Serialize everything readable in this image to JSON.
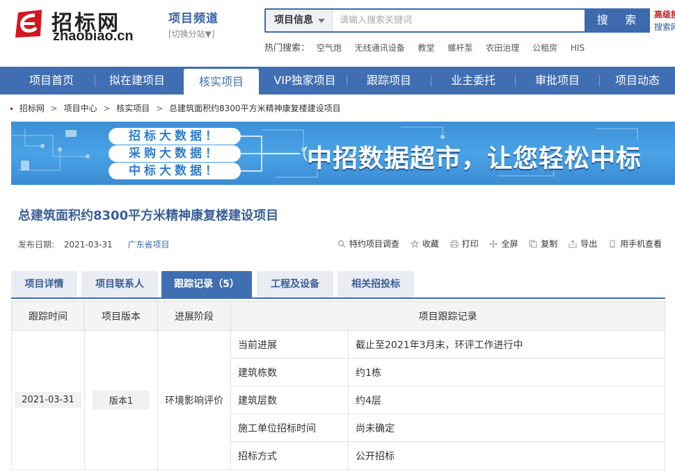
{
  "logo": {
    "cn": "招标网",
    "en": "zhaobiao.cn"
  },
  "channel": {
    "title": "项目频道",
    "switch": "[切换分站▼]"
  },
  "search": {
    "category": "项目信息",
    "placeholder": "请输入搜索关键词",
    "button": "搜 索",
    "advanced": "高级搜",
    "advanced2": "搜索网"
  },
  "hot": {
    "label": "热门搜索：",
    "items": [
      "空气炮",
      "无线通讯设备",
      "教堂",
      "螺杆泵",
      "农田治理",
      "公租房",
      "HIS"
    ]
  },
  "nav": {
    "items": [
      "项目首页",
      "拟在建项目",
      "核实项目",
      "VIP独家项目",
      "跟踪项目",
      "业主委托",
      "审批项目",
      "项目动态"
    ],
    "active_index": 2
  },
  "breadcrumb": [
    "招标网",
    "项目中心",
    "核实项目",
    "总建筑面积约8300平方米精神康复楼建设项目"
  ],
  "banner": {
    "pills": [
      "招标大数据！",
      "采购大数据！",
      "中标大数据！"
    ],
    "slogan": "中招数据超市，让您轻松中标"
  },
  "project": {
    "title": "总建筑面积约8300平方米精神康复楼建设项目",
    "date_label": "发布日期:",
    "date": "2021-03-31",
    "region": "广东省项目"
  },
  "tools": [
    {
      "icon": "search-icon",
      "label": "特约项目调查"
    },
    {
      "icon": "star-icon",
      "label": "收藏"
    },
    {
      "icon": "printer-icon",
      "label": "打印"
    },
    {
      "icon": "fullscreen-icon",
      "label": "全屏"
    },
    {
      "icon": "copy-icon",
      "label": "复制"
    },
    {
      "icon": "export-icon",
      "label": "导出"
    },
    {
      "icon": "phone-icon",
      "label": "用手机查看"
    }
  ],
  "tabs": [
    "项目详情",
    "项目联系人",
    "跟踪记录（5）",
    "工程及设备",
    "相关招投标"
  ],
  "active_tab": 2,
  "table": {
    "headers": [
      "跟踪时间",
      "项目版本",
      "进展阶段",
      "项目跟踪记录"
    ],
    "time": "2021-03-31",
    "version": "版本1",
    "stage": "环境影响评价",
    "records": [
      {
        "k": "当前进展",
        "v": "截止至2021年3月末，环评工作进行中"
      },
      {
        "k": "建筑栋数",
        "v": "约1栋"
      },
      {
        "k": "建筑层数",
        "v": "约4层"
      },
      {
        "k": "施工单位招标时间",
        "v": "尚未确定"
      },
      {
        "k": "招标方式",
        "v": "公开招标"
      }
    ]
  },
  "colors": {
    "brand_blue": "#3f6eb3",
    "brand_red": "#c4141b"
  }
}
